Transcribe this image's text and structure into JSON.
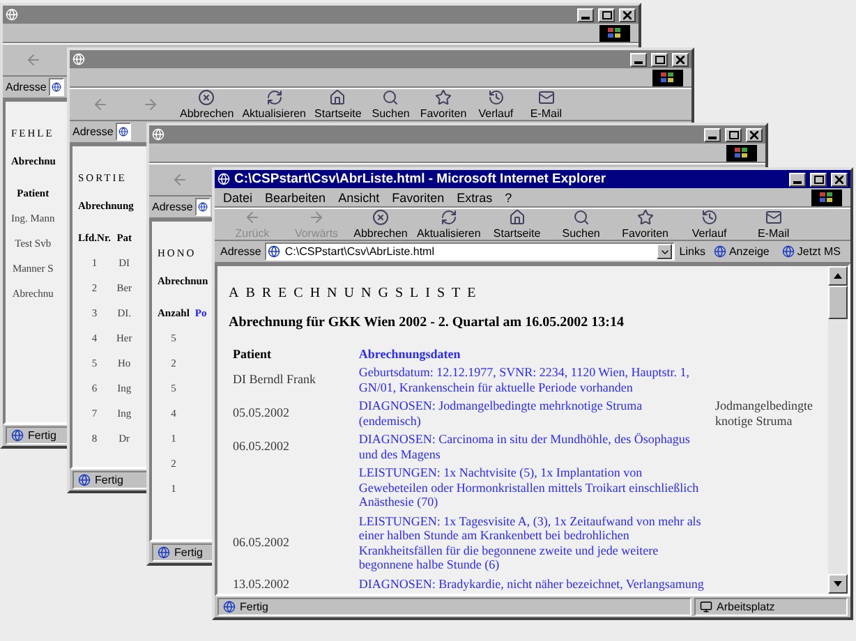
{
  "windows": [
    {
      "active": false,
      "toolbar": [
        {
          "kind": "back",
          "disabled": true
        }
      ],
      "address_label": "Adresse",
      "content": {
        "heading": "FEHLE",
        "subtitle": "Abrechnu",
        "columns": [
          {
            "heading": "Patient",
            "kind": "plain"
          }
        ],
        "rows": [
          [
            "Ing. Mann"
          ],
          [
            "Test Svb"
          ],
          [
            "Manner S"
          ],
          [
            "Abrechnu"
          ]
        ]
      },
      "status": "Fertig"
    },
    {
      "active": false,
      "toolbar": [
        {
          "kind": "back",
          "disabled": true
        },
        {
          "kind": "forward",
          "disabled": true
        },
        {
          "kind": "stop",
          "label": "Abbrechen",
          "disabled": false
        },
        {
          "kind": "refresh",
          "label": "Aktualisieren",
          "disabled": false
        },
        {
          "kind": "home",
          "label": "Startseite",
          "disabled": false
        },
        {
          "kind": "search",
          "label": "Suchen",
          "disabled": false
        },
        {
          "kind": "favorites",
          "label": "Favoriten",
          "disabled": false
        },
        {
          "kind": "history",
          "label": "Verlauf",
          "disabled": false
        },
        {
          "kind": "mail",
          "label": "E-Mail",
          "disabled": false
        }
      ],
      "address_label": "Adresse",
      "content": {
        "heading": "SORTIE",
        "subtitle": "Abrechnung",
        "columns": [
          {
            "heading": "Lfd.Nr.",
            "kind": "plain"
          },
          {
            "heading": "Pat",
            "kind": "plain"
          }
        ],
        "rows": [
          [
            "1",
            "DI"
          ],
          [
            "2",
            "Ber"
          ],
          [
            "3",
            "DI."
          ],
          [
            "4",
            "Her"
          ],
          [
            "5",
            "Ho"
          ],
          [
            "6",
            "Ing"
          ],
          [
            "7",
            "Ing"
          ],
          [
            "8",
            "Dr"
          ]
        ]
      },
      "status": "Fertig"
    },
    {
      "active": false,
      "toolbar": [
        {
          "kind": "back",
          "disabled": true
        }
      ],
      "address_label": "Adresse",
      "content": {
        "heading": "HONO",
        "subtitle": "Abrechnun",
        "columns": [
          {
            "heading": "Anzahl",
            "kind": "plain"
          },
          {
            "heading": "Po",
            "kind": "link"
          }
        ],
        "rows": [
          [
            "5"
          ],
          [
            "2"
          ],
          [
            "5"
          ],
          [
            "4"
          ],
          [
            "1"
          ],
          [
            "2"
          ],
          [
            "1"
          ]
        ]
      },
      "status": "Fertig"
    },
    {
      "active": true,
      "title": "C:\\CSPstart\\Csv\\AbrListe.html - Microsoft Internet Explorer",
      "menu": [
        "Datei",
        "Bearbeiten",
        "Ansicht",
        "Favoriten",
        "Extras",
        "?"
      ],
      "toolbar": [
        {
          "kind": "back",
          "label": "Zurück",
          "disabled": true
        },
        {
          "kind": "forward",
          "label": "Vorwärts",
          "disabled": true
        },
        {
          "kind": "stop",
          "label": "Abbrechen",
          "disabled": false
        },
        {
          "kind": "refresh",
          "label": "Aktualisieren",
          "disabled": false
        },
        {
          "kind": "home",
          "label": "Startseite",
          "disabled": false
        },
        {
          "kind": "search",
          "label": "Suchen",
          "disabled": false
        },
        {
          "kind": "favorites",
          "label": "Favoriten",
          "disabled": false
        },
        {
          "kind": "history",
          "label": "Verlauf",
          "disabled": false
        },
        {
          "kind": "mail",
          "label": "E-Mail",
          "disabled": false
        }
      ],
      "address_label": "Adresse",
      "address": "C:\\CSPstart\\Csv\\AbrListe.html",
      "links": {
        "label": "Links",
        "items": [
          "Anzeige",
          "Jetzt MS"
        ]
      },
      "content": {
        "heading": "ABRECHNUNGSLISTE",
        "subtitle": "Abrechnung für GKK Wien 2002 - 2. Quartal am 16.05.2002 13:14",
        "columns": [
          {
            "heading": "Patient",
            "kind": "plain"
          },
          {
            "heading": "Abrechnungsdaten",
            "kind": "link"
          },
          {
            "kind": "plain"
          }
        ],
        "rows": [
          [
            "DI Berndl Frank",
            "Geburtsdatum: 12.12.1977, SVNR: 2234, 1120 Wien, Hauptstr. 1, GN/01, Krankenschein für aktuelle Periode vorhanden"
          ],
          [
            "05.05.2002",
            "DIAGNOSEN: Jodmangelbedingte mehrknotige Struma (endemisch)",
            "Jodmangelbedingte knotige Struma"
          ],
          [
            "06.05.2002",
            "DIAGNOSEN: Carcinoma in situ der Mundhöhle, des Ösophagus und des Magens"
          ],
          [
            "",
            "LEISTUNGEN: 1x Nachtvisite (5), 1x Implantation von Gewebeteilen oder Hormonkristallen mittels Troikart einschließlich Anästhesie (70)"
          ],
          [
            "06.05.2002",
            "LEISTUNGEN: 1x Tagesvisite A, (3), 1x Zeitaufwand von mehr als einer halben Stunde am Krankenbett bei bedrohlichen Krankheitsfällen für die begonnene zweite und jede weitere begonnene halbe Stunde (6)"
          ],
          [
            "13.05.2002",
            "DIAGNOSEN: Bradykardie, nicht näher bezeichnet, Verlangsamung"
          ]
        ]
      },
      "status": "Fertig",
      "zone": "Arbeitsplatz"
    }
  ]
}
